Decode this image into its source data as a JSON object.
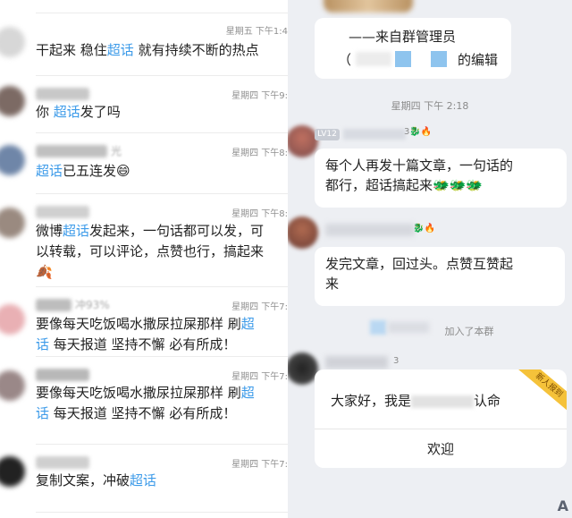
{
  "left": {
    "top_partial_text": "",
    "comments": [
      {
        "time": "星期五 下午1:4",
        "name": "",
        "parts": [
          {
            "t": "干起来 稳住"
          },
          {
            "t": "超话",
            "hl": true
          },
          {
            "t": " 就有持续不断的热点"
          }
        ]
      },
      {
        "time": "星期四 下午9:",
        "name": "",
        "parts": [
          {
            "t": "你 "
          },
          {
            "t": "超话",
            "hl": true
          },
          {
            "t": "发了吗"
          }
        ]
      },
      {
        "time": "星期四 下午8:",
        "name": "光",
        "parts": [
          {
            "t": "超话",
            "hl": true
          },
          {
            "t": "已五连发"
          },
          {
            "t": "😄"
          }
        ]
      },
      {
        "time": "星期四 下午8:",
        "name": "",
        "lines": [
          [
            {
              "t": "微博"
            },
            {
              "t": "超话",
              "hl": true
            },
            {
              "t": "发起来，一句话都可以发，可"
            }
          ],
          [
            {
              "t": "以转载，可以评论，点赞也行，搞起来"
            }
          ],
          [
            {
              "t": "🍂"
            }
          ]
        ]
      },
      {
        "time": "星期四 下午7:",
        "name": "冲93%",
        "lines": [
          [
            {
              "t": "要像每天吃饭喝水撒尿拉屎那样 刷"
            },
            {
              "t": "超",
              "hl": true
            }
          ],
          [
            {
              "t": "话",
              "hl": true
            },
            {
              "t": "  每天报道   坚持不懈   必有所成！"
            }
          ]
        ]
      },
      {
        "time": "星期四 下午7:",
        "name": "",
        "lines": [
          [
            {
              "t": "要像每天吃饭喝水撒尿拉屎那样 刷"
            },
            {
              "t": "超",
              "hl": true
            }
          ],
          [
            {
              "t": "话",
              "hl": true
            },
            {
              "t": "  每天报道   坚持不懈   必有所成！"
            }
          ]
        ]
      },
      {
        "time": "星期四 下午7:",
        "name": "",
        "parts": [
          {
            "t": "复制文案，冲破"
          },
          {
            "t": "超话",
            "hl": true
          }
        ]
      }
    ]
  },
  "right": {
    "admin_signature": "——来自群管理员",
    "admin_edit": "的编辑",
    "admin_paren": "（",
    "time1": "星期四 下午 2:18",
    "lv_badge": "LV12",
    "icons1": "3🐉🔥",
    "msg1_line1": "每个人再发十篇文章，一句话的",
    "msg1_line2": "都行，超话搞起来🐲🐲🐲",
    "icons2": "🐉🔥",
    "msg2_line1": "发完文章，回过头。点赞互赞起",
    "msg2_line2": "来",
    "join_notice": "加入了本群",
    "icons3": "3",
    "welcome_greet": "大家好，我是",
    "welcome_tail": "认命",
    "welcome_button": "欢迎",
    "ribbon": "新人报到",
    "corner": "A"
  }
}
